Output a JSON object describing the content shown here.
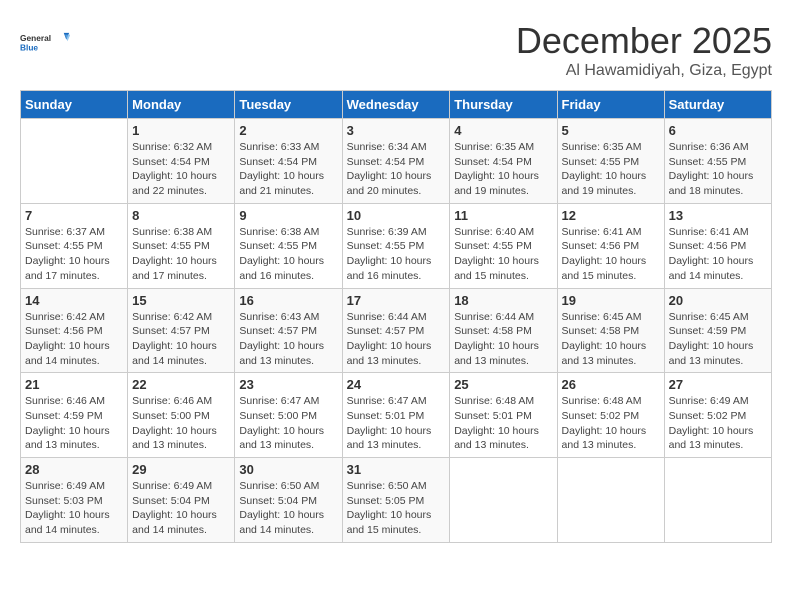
{
  "logo": {
    "general": "General",
    "blue": "Blue"
  },
  "title": "December 2025",
  "location": "Al Hawamidiyah, Giza, Egypt",
  "weekdays": [
    "Sunday",
    "Monday",
    "Tuesday",
    "Wednesday",
    "Thursday",
    "Friday",
    "Saturday"
  ],
  "weeks": [
    [
      {
        "day": "",
        "info": ""
      },
      {
        "day": "1",
        "info": "Sunrise: 6:32 AM\nSunset: 4:54 PM\nDaylight: 10 hours\nand 22 minutes."
      },
      {
        "day": "2",
        "info": "Sunrise: 6:33 AM\nSunset: 4:54 PM\nDaylight: 10 hours\nand 21 minutes."
      },
      {
        "day": "3",
        "info": "Sunrise: 6:34 AM\nSunset: 4:54 PM\nDaylight: 10 hours\nand 20 minutes."
      },
      {
        "day": "4",
        "info": "Sunrise: 6:35 AM\nSunset: 4:54 PM\nDaylight: 10 hours\nand 19 minutes."
      },
      {
        "day": "5",
        "info": "Sunrise: 6:35 AM\nSunset: 4:55 PM\nDaylight: 10 hours\nand 19 minutes."
      },
      {
        "day": "6",
        "info": "Sunrise: 6:36 AM\nSunset: 4:55 PM\nDaylight: 10 hours\nand 18 minutes."
      }
    ],
    [
      {
        "day": "7",
        "info": "Sunrise: 6:37 AM\nSunset: 4:55 PM\nDaylight: 10 hours\nand 17 minutes."
      },
      {
        "day": "8",
        "info": "Sunrise: 6:38 AM\nSunset: 4:55 PM\nDaylight: 10 hours\nand 17 minutes."
      },
      {
        "day": "9",
        "info": "Sunrise: 6:38 AM\nSunset: 4:55 PM\nDaylight: 10 hours\nand 16 minutes."
      },
      {
        "day": "10",
        "info": "Sunrise: 6:39 AM\nSunset: 4:55 PM\nDaylight: 10 hours\nand 16 minutes."
      },
      {
        "day": "11",
        "info": "Sunrise: 6:40 AM\nSunset: 4:55 PM\nDaylight: 10 hours\nand 15 minutes."
      },
      {
        "day": "12",
        "info": "Sunrise: 6:41 AM\nSunset: 4:56 PM\nDaylight: 10 hours\nand 15 minutes."
      },
      {
        "day": "13",
        "info": "Sunrise: 6:41 AM\nSunset: 4:56 PM\nDaylight: 10 hours\nand 14 minutes."
      }
    ],
    [
      {
        "day": "14",
        "info": "Sunrise: 6:42 AM\nSunset: 4:56 PM\nDaylight: 10 hours\nand 14 minutes."
      },
      {
        "day": "15",
        "info": "Sunrise: 6:42 AM\nSunset: 4:57 PM\nDaylight: 10 hours\nand 14 minutes."
      },
      {
        "day": "16",
        "info": "Sunrise: 6:43 AM\nSunset: 4:57 PM\nDaylight: 10 hours\nand 13 minutes."
      },
      {
        "day": "17",
        "info": "Sunrise: 6:44 AM\nSunset: 4:57 PM\nDaylight: 10 hours\nand 13 minutes."
      },
      {
        "day": "18",
        "info": "Sunrise: 6:44 AM\nSunset: 4:58 PM\nDaylight: 10 hours\nand 13 minutes."
      },
      {
        "day": "19",
        "info": "Sunrise: 6:45 AM\nSunset: 4:58 PM\nDaylight: 10 hours\nand 13 minutes."
      },
      {
        "day": "20",
        "info": "Sunrise: 6:45 AM\nSunset: 4:59 PM\nDaylight: 10 hours\nand 13 minutes."
      }
    ],
    [
      {
        "day": "21",
        "info": "Sunrise: 6:46 AM\nSunset: 4:59 PM\nDaylight: 10 hours\nand 13 minutes."
      },
      {
        "day": "22",
        "info": "Sunrise: 6:46 AM\nSunset: 5:00 PM\nDaylight: 10 hours\nand 13 minutes."
      },
      {
        "day": "23",
        "info": "Sunrise: 6:47 AM\nSunset: 5:00 PM\nDaylight: 10 hours\nand 13 minutes."
      },
      {
        "day": "24",
        "info": "Sunrise: 6:47 AM\nSunset: 5:01 PM\nDaylight: 10 hours\nand 13 minutes."
      },
      {
        "day": "25",
        "info": "Sunrise: 6:48 AM\nSunset: 5:01 PM\nDaylight: 10 hours\nand 13 minutes."
      },
      {
        "day": "26",
        "info": "Sunrise: 6:48 AM\nSunset: 5:02 PM\nDaylight: 10 hours\nand 13 minutes."
      },
      {
        "day": "27",
        "info": "Sunrise: 6:49 AM\nSunset: 5:02 PM\nDaylight: 10 hours\nand 13 minutes."
      }
    ],
    [
      {
        "day": "28",
        "info": "Sunrise: 6:49 AM\nSunset: 5:03 PM\nDaylight: 10 hours\nand 14 minutes."
      },
      {
        "day": "29",
        "info": "Sunrise: 6:49 AM\nSunset: 5:04 PM\nDaylight: 10 hours\nand 14 minutes."
      },
      {
        "day": "30",
        "info": "Sunrise: 6:50 AM\nSunset: 5:04 PM\nDaylight: 10 hours\nand 14 minutes."
      },
      {
        "day": "31",
        "info": "Sunrise: 6:50 AM\nSunset: 5:05 PM\nDaylight: 10 hours\nand 15 minutes."
      },
      {
        "day": "",
        "info": ""
      },
      {
        "day": "",
        "info": ""
      },
      {
        "day": "",
        "info": ""
      }
    ]
  ]
}
